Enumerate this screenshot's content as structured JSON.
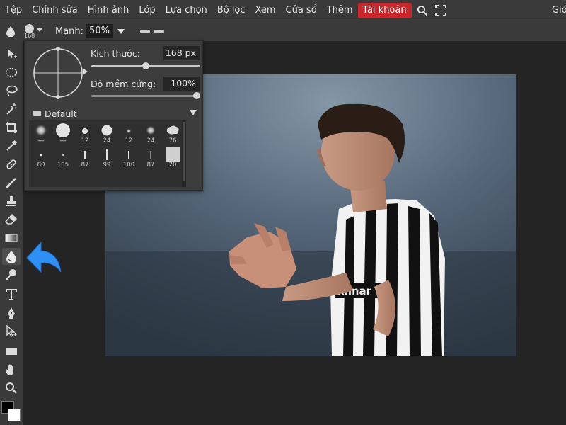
{
  "menubar": {
    "items": [
      "Tệp",
      "Chỉnh sửa",
      "Hình ảnh",
      "Lớp",
      "Lựa chọn",
      "Bộ lọc",
      "Xem",
      "Cửa sổ",
      "Thêm"
    ],
    "account_label": "Tài khoản",
    "right_label": "Giớ",
    "account_color": "#c8262a"
  },
  "options": {
    "tool_icon": "blur-drop-icon",
    "brush_size": "168",
    "strength_label": "Mạnh:",
    "strength_value": "50%"
  },
  "popup": {
    "size_label": "Kích thước:",
    "size_value": "168",
    "size_unit": "px",
    "size_fraction": 0.5,
    "hardness_label": "Độ mềm cứng:",
    "hardness_value": "100%",
    "hardness_fraction": 1.0,
    "preset_folder": "Default",
    "presets": [
      {
        "label": "---",
        "kind": "soft-large"
      },
      {
        "label": "---",
        "kind": "hard-xl"
      },
      {
        "label": "12",
        "kind": "hard-small"
      },
      {
        "label": "24",
        "kind": "hard-medium"
      },
      {
        "label": "12",
        "kind": "soft-small"
      },
      {
        "label": "24",
        "kind": "soft-medium"
      },
      {
        "label": "76",
        "kind": "splatter"
      },
      {
        "label": "80",
        "kind": "tiny-dot"
      },
      {
        "label": "105",
        "kind": "tiny-dot2"
      },
      {
        "label": "87",
        "kind": "stroke-short"
      },
      {
        "label": "99",
        "kind": "stroke-tall"
      },
      {
        "label": "100",
        "kind": "stroke-short"
      },
      {
        "label": "87",
        "kind": "stroke-thin"
      },
      {
        "label": "20",
        "kind": "square"
      }
    ]
  },
  "toolbar": {
    "tools": [
      "move-icon",
      "marquee-icon",
      "lasso-icon",
      "magic-wand-icon",
      "crop-icon",
      "eyedropper-icon",
      "healing-icon",
      "brush-icon",
      "stamp-icon",
      "eraser-icon",
      "gradient-icon",
      "blur-drop-icon",
      "sponge-icon",
      "type-icon",
      "pen-icon",
      "select-arrow-icon",
      "rectangle-icon",
      "hand-icon",
      "zoom-icon"
    ],
    "active_tool": "blur-drop-icon",
    "foreground_color": "#000000",
    "background_color": "#ffffff"
  },
  "canvas": {
    "annotation_color": "#2f8ff5"
  }
}
